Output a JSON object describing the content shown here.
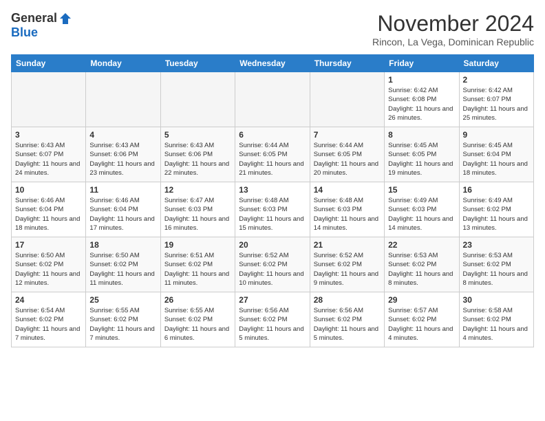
{
  "header": {
    "logo_general": "General",
    "logo_blue": "Blue",
    "month_title": "November 2024",
    "location": "Rincon, La Vega, Dominican Republic"
  },
  "calendar": {
    "weekdays": [
      "Sunday",
      "Monday",
      "Tuesday",
      "Wednesday",
      "Thursday",
      "Friday",
      "Saturday"
    ],
    "weeks": [
      [
        {
          "day": "",
          "info": ""
        },
        {
          "day": "",
          "info": ""
        },
        {
          "day": "",
          "info": ""
        },
        {
          "day": "",
          "info": ""
        },
        {
          "day": "",
          "info": ""
        },
        {
          "day": "1",
          "info": "Sunrise: 6:42 AM\nSunset: 6:08 PM\nDaylight: 11 hours and 26 minutes."
        },
        {
          "day": "2",
          "info": "Sunrise: 6:42 AM\nSunset: 6:07 PM\nDaylight: 11 hours and 25 minutes."
        }
      ],
      [
        {
          "day": "3",
          "info": "Sunrise: 6:43 AM\nSunset: 6:07 PM\nDaylight: 11 hours and 24 minutes."
        },
        {
          "day": "4",
          "info": "Sunrise: 6:43 AM\nSunset: 6:06 PM\nDaylight: 11 hours and 23 minutes."
        },
        {
          "day": "5",
          "info": "Sunrise: 6:43 AM\nSunset: 6:06 PM\nDaylight: 11 hours and 22 minutes."
        },
        {
          "day": "6",
          "info": "Sunrise: 6:44 AM\nSunset: 6:05 PM\nDaylight: 11 hours and 21 minutes."
        },
        {
          "day": "7",
          "info": "Sunrise: 6:44 AM\nSunset: 6:05 PM\nDaylight: 11 hours and 20 minutes."
        },
        {
          "day": "8",
          "info": "Sunrise: 6:45 AM\nSunset: 6:05 PM\nDaylight: 11 hours and 19 minutes."
        },
        {
          "day": "9",
          "info": "Sunrise: 6:45 AM\nSunset: 6:04 PM\nDaylight: 11 hours and 18 minutes."
        }
      ],
      [
        {
          "day": "10",
          "info": "Sunrise: 6:46 AM\nSunset: 6:04 PM\nDaylight: 11 hours and 18 minutes."
        },
        {
          "day": "11",
          "info": "Sunrise: 6:46 AM\nSunset: 6:04 PM\nDaylight: 11 hours and 17 minutes."
        },
        {
          "day": "12",
          "info": "Sunrise: 6:47 AM\nSunset: 6:03 PM\nDaylight: 11 hours and 16 minutes."
        },
        {
          "day": "13",
          "info": "Sunrise: 6:48 AM\nSunset: 6:03 PM\nDaylight: 11 hours and 15 minutes."
        },
        {
          "day": "14",
          "info": "Sunrise: 6:48 AM\nSunset: 6:03 PM\nDaylight: 11 hours and 14 minutes."
        },
        {
          "day": "15",
          "info": "Sunrise: 6:49 AM\nSunset: 6:03 PM\nDaylight: 11 hours and 14 minutes."
        },
        {
          "day": "16",
          "info": "Sunrise: 6:49 AM\nSunset: 6:02 PM\nDaylight: 11 hours and 13 minutes."
        }
      ],
      [
        {
          "day": "17",
          "info": "Sunrise: 6:50 AM\nSunset: 6:02 PM\nDaylight: 11 hours and 12 minutes."
        },
        {
          "day": "18",
          "info": "Sunrise: 6:50 AM\nSunset: 6:02 PM\nDaylight: 11 hours and 11 minutes."
        },
        {
          "day": "19",
          "info": "Sunrise: 6:51 AM\nSunset: 6:02 PM\nDaylight: 11 hours and 11 minutes."
        },
        {
          "day": "20",
          "info": "Sunrise: 6:52 AM\nSunset: 6:02 PM\nDaylight: 11 hours and 10 minutes."
        },
        {
          "day": "21",
          "info": "Sunrise: 6:52 AM\nSunset: 6:02 PM\nDaylight: 11 hours and 9 minutes."
        },
        {
          "day": "22",
          "info": "Sunrise: 6:53 AM\nSunset: 6:02 PM\nDaylight: 11 hours and 8 minutes."
        },
        {
          "day": "23",
          "info": "Sunrise: 6:53 AM\nSunset: 6:02 PM\nDaylight: 11 hours and 8 minutes."
        }
      ],
      [
        {
          "day": "24",
          "info": "Sunrise: 6:54 AM\nSunset: 6:02 PM\nDaylight: 11 hours and 7 minutes."
        },
        {
          "day": "25",
          "info": "Sunrise: 6:55 AM\nSunset: 6:02 PM\nDaylight: 11 hours and 7 minutes."
        },
        {
          "day": "26",
          "info": "Sunrise: 6:55 AM\nSunset: 6:02 PM\nDaylight: 11 hours and 6 minutes."
        },
        {
          "day": "27",
          "info": "Sunrise: 6:56 AM\nSunset: 6:02 PM\nDaylight: 11 hours and 5 minutes."
        },
        {
          "day": "28",
          "info": "Sunrise: 6:56 AM\nSunset: 6:02 PM\nDaylight: 11 hours and 5 minutes."
        },
        {
          "day": "29",
          "info": "Sunrise: 6:57 AM\nSunset: 6:02 PM\nDaylight: 11 hours and 4 minutes."
        },
        {
          "day": "30",
          "info": "Sunrise: 6:58 AM\nSunset: 6:02 PM\nDaylight: 11 hours and 4 minutes."
        }
      ]
    ]
  }
}
